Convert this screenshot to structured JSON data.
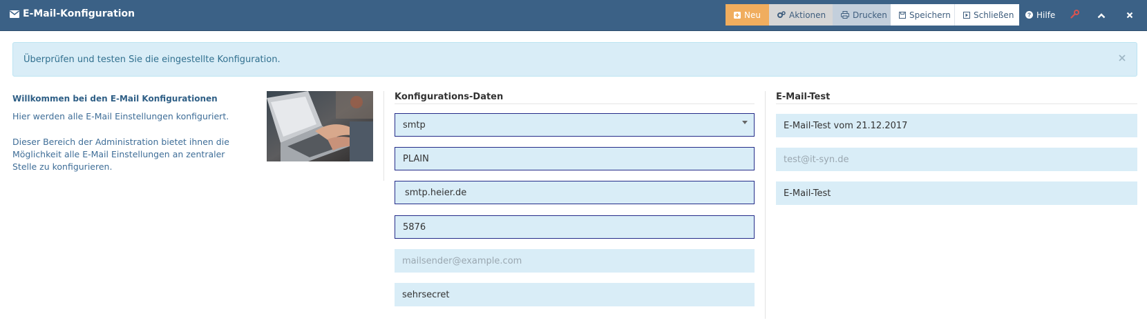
{
  "header": {
    "title": "E-Mail-Konfiguration",
    "title_icon": "envelope-icon",
    "buttons": {
      "neu": "Neu",
      "aktionen": "Aktionen",
      "drucken": "Drucken",
      "speichern": "Speichern",
      "schliessen": "Schließen",
      "hilfe": "Hilfe"
    },
    "colors": {
      "bar": "#3b6186",
      "neu": "#f0ad5e",
      "wrench": "#d9534f"
    }
  },
  "alert": {
    "text": "Überprüfen und testen Sie die eingestellte Konfiguration.",
    "close_icon": "close-icon"
  },
  "intro": {
    "heading": "Willkommen bei den E-Mail Konfigurationen",
    "line1": "Hier werden alle E-Mail Einstellungen konfiguriert.",
    "paragraph": "Dieser Bereich der Administration bietet ihnen die Möglichkeit alle E-Mail Einstellungen an zentraler Stelle zu konfigurieren."
  },
  "config": {
    "title": "Konfigurations-Daten",
    "transport": "smtp",
    "auth": "PLAIN",
    "host": "smtp.heier.de",
    "port": "5876",
    "sender_placeholder": "mailsender@example.com",
    "password": "sehrsecret"
  },
  "test": {
    "title": "E-Mail-Test",
    "subject": "E-Mail-Test vom 21.12.2017",
    "recipient_placeholder": "test@it-syn.de",
    "button_label": "E-Mail-Test"
  }
}
